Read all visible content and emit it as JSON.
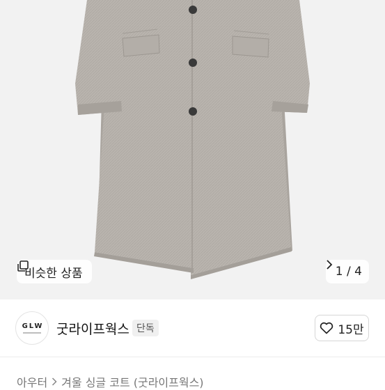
{
  "gallery": {
    "similar_label": "비슷한 상품",
    "similar_icon": "copy-icon",
    "page_current": "1",
    "page_separator": "/",
    "page_total": "4",
    "next_icon": "chevron-right-icon"
  },
  "shop": {
    "logo_text": "GLW",
    "name": "굿라이프웍스",
    "badge": "단독",
    "like_icon": "heart-outline-icon",
    "like_count": "15만"
  },
  "breadcrumb": {
    "category": "아우터",
    "product": "겨울 싱글 코트 (굿라이프웍스)"
  },
  "colors": {
    "coat": "#b8b3ad",
    "background": "#f2f2f2",
    "button_bg": "#3a3a3a"
  }
}
